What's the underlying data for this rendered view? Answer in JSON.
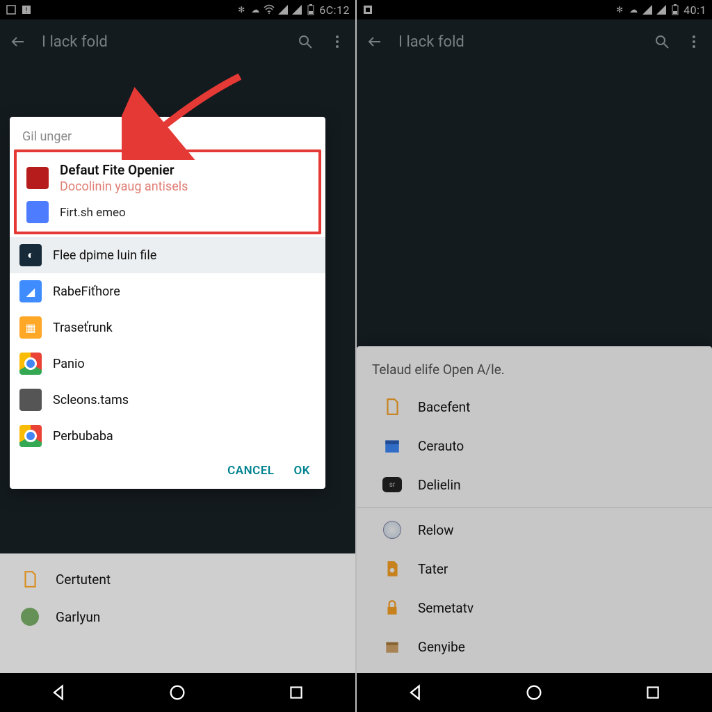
{
  "left": {
    "status": {
      "clock": "6C:12"
    },
    "appbar": {
      "title": "I lack fold"
    },
    "dialog": {
      "title": "Gil unger",
      "highlight": {
        "main": "Defaut Fite Openier",
        "sub": "Docolinin yaug antisels",
        "sub2": "Firt.sh emeo"
      },
      "options": [
        {
          "label": "Flee dpime luin file",
          "selected": true,
          "icon": "circle-dark"
        },
        {
          "label": "RabeFiťhore",
          "icon": "folder"
        },
        {
          "label": "Traseťrunk",
          "icon": "doc"
        },
        {
          "label": "Panio",
          "icon": "chrome"
        },
        {
          "label": "Scleons.tams",
          "icon": "gray"
        },
        {
          "label": "Perbubaba",
          "icon": "chrome"
        }
      ],
      "cancel": "CANCEL",
      "ok": "OK"
    },
    "bg_items": [
      {
        "label": "Certutent",
        "icon": "orange-doc"
      },
      {
        "label": "Garlyun",
        "icon": "gray-circ"
      }
    ]
  },
  "right": {
    "status": {
      "clock": "40:1"
    },
    "appbar": {
      "title": "I lack fold"
    },
    "sheet": {
      "title": "Telaud elife Open A/le.",
      "groups": [
        [
          {
            "label": "Bacefent",
            "icon": "orange-doc"
          },
          {
            "label": "Cerauto",
            "icon": "blue-cal"
          },
          {
            "label": "Delielin",
            "icon": "black-box"
          }
        ],
        [
          {
            "label": "Relow",
            "icon": "globe"
          },
          {
            "label": "Tater",
            "icon": "orange-doc"
          },
          {
            "label": "Semetatv",
            "icon": "lock"
          },
          {
            "label": "Genyibe",
            "icon": "box"
          }
        ]
      ]
    }
  }
}
